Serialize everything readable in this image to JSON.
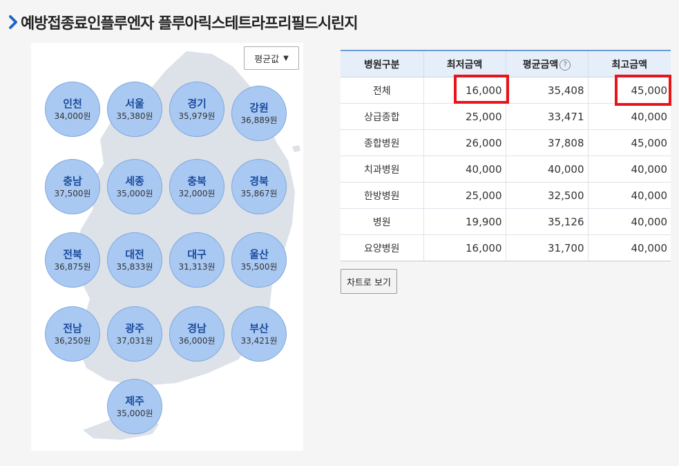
{
  "page": {
    "title": "예방접종료인플루엔자 플루아릭스테트라프리필드시린지"
  },
  "filter": {
    "selected": "평균값"
  },
  "regions": [
    {
      "name": "인천",
      "price": "34,000원"
    },
    {
      "name": "서울",
      "price": "35,380원"
    },
    {
      "name": "경기",
      "price": "35,979원"
    },
    {
      "name": "강원",
      "price": "36,889원"
    },
    {
      "name": "충남",
      "price": "37,500원"
    },
    {
      "name": "세종",
      "price": "35,000원"
    },
    {
      "name": "충북",
      "price": "32,000원"
    },
    {
      "name": "경북",
      "price": "35,867원"
    },
    {
      "name": "전북",
      "price": "36,875원"
    },
    {
      "name": "대전",
      "price": "35,833원"
    },
    {
      "name": "대구",
      "price": "31,313원"
    },
    {
      "name": "울산",
      "price": "35,500원"
    },
    {
      "name": "전남",
      "price": "36,250원"
    },
    {
      "name": "광주",
      "price": "37,031원"
    },
    {
      "name": "경남",
      "price": "36,000원"
    },
    {
      "name": "부산",
      "price": "33,421원"
    },
    {
      "name": "제주",
      "price": "35,000원"
    }
  ],
  "table": {
    "headers": [
      "병원구분",
      "최저금액",
      "평균금액",
      "최고금액"
    ],
    "rows": [
      [
        "전체",
        "16,000",
        "35,408",
        "45,000"
      ],
      [
        "상급종합",
        "25,000",
        "33,471",
        "40,000"
      ],
      [
        "종합병원",
        "26,000",
        "37,808",
        "45,000"
      ],
      [
        "치과병원",
        "40,000",
        "40,000",
        "40,000"
      ],
      [
        "한방병원",
        "25,000",
        "32,500",
        "40,000"
      ],
      [
        "병원",
        "19,900",
        "35,126",
        "40,000"
      ],
      [
        "요양병원",
        "16,000",
        "31,700",
        "40,000"
      ]
    ]
  },
  "actions": {
    "chart_view": "차트로 보기"
  },
  "icons": {
    "title_arrow": "chevron-right-icon",
    "help": "question-circle-icon",
    "dropdown": "chevron-down-icon"
  },
  "colors": {
    "accent": "#1f64c8",
    "circle_fill": "#a9c9f3",
    "highlight": "#e8141a"
  }
}
